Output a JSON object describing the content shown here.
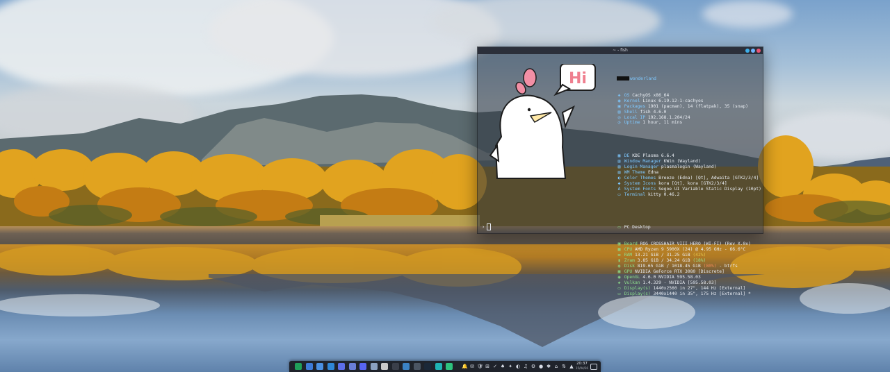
{
  "terminal": {
    "title": "~ - fish",
    "prompt_symbol": "›",
    "user_host": "wonderland",
    "speech_bubble": "Hi",
    "sections": {
      "system": [
        {
          "key": "OS",
          "value": "CachyOS x86_64",
          "icon": "os-icon"
        },
        {
          "key": "Kernel",
          "value": "Linux 6.19.12-1-cachyos",
          "icon": "kernel-icon"
        },
        {
          "key": "Packages",
          "value": "1901 (pacman), 14 (flatpak), 35 (snap)",
          "icon": "package-icon"
        },
        {
          "key": "Shell",
          "value": "fish 4.6.0",
          "icon": "shell-icon"
        },
        {
          "key": "Local IP",
          "value": "192.168.1.204/24",
          "icon": "network-icon"
        },
        {
          "key": "Uptime",
          "value": "1 hour, 11 mins",
          "icon": "clock-icon"
        }
      ],
      "desktop": [
        {
          "key": "DE",
          "value": "KDE Plasma 6.6.4",
          "icon": "de-icon"
        },
        {
          "key": "Window Manager",
          "value": "KWin (Wayland)",
          "icon": "wm-icon"
        },
        {
          "key": "Login Manager",
          "value": "plasmalogin (Wayland)",
          "icon": "login-icon"
        },
        {
          "key": "WM Theme",
          "value": "Edna",
          "icon": "theme-icon"
        },
        {
          "key": "Color Themes",
          "value": "Breeze (Edna) [Qt], Adwaita [GTK2/3/4]",
          "icon": "palette-icon"
        },
        {
          "key": "System Icons",
          "value": "kora [Qt], kora [GTK2/3/4]",
          "icon": "icons-icon"
        },
        {
          "key": "System Fonts",
          "value": "Segoe UI Variable Static Display (10pt)",
          "icon": "font-icon"
        },
        {
          "key": "Terminal",
          "value": "kitty 0.46.2",
          "icon": "terminal-icon"
        }
      ],
      "hardware_title": "PC Desktop",
      "hardware": [
        {
          "key": "Board",
          "value": "ROG CROSSHAIR VIII HERO (WI-FI) (Rev X.0x)",
          "icon": "board-icon"
        },
        {
          "key": "CPU",
          "value": "AMD Ryzen 9 5900X (24) @ 4.95 GHz - 66.6°C",
          "icon": "cpu-icon"
        },
        {
          "key": "RAM",
          "value": "13.21 GiB / 31.25 GiB",
          "pct": "(42%)",
          "pct_class": "pct",
          "icon": "ram-icon"
        },
        {
          "key": "Zram",
          "value": "3.85 GiB / 34.24 GiB",
          "pct": "(18%)",
          "pct_class": "pct-g",
          "icon": "zram-icon"
        },
        {
          "key": "Disk",
          "value": "819.65 GiB / 1018.45 GiB",
          "pct": "(80%)",
          "pct_suffix": " - btrfs",
          "pct_class": "pct-r",
          "icon": "disk-icon"
        },
        {
          "key": "GPU",
          "value": "NVIDIA GeForce RTX 3080 [Discrete]",
          "icon": "gpu-icon"
        },
        {
          "key": "OpenGL",
          "value": "4.6.0 NVIDIA 595.58.03",
          "icon": "opengl-icon"
        },
        {
          "key": "Vulkan",
          "value": "1.4.329 - NVIDIA [595.58.03]",
          "icon": "vulkan-icon"
        },
        {
          "key": "Display(s)",
          "value": "1440x2560 in 27\", 144 Hz [External]",
          "icon": "display-icon"
        },
        {
          "key": "Display(s)",
          "value": "3440x1440 in 35\", 175 Hz [External] *",
          "icon": "display-icon"
        }
      ]
    }
  },
  "taskbar": {
    "apps": [
      {
        "name": "cachyos-launcher-icon",
        "color": "#1fa05a"
      },
      {
        "name": "overview-icon",
        "color": "#3d7bd8"
      },
      {
        "name": "file-manager-icon",
        "color": "#4a90e2"
      },
      {
        "name": "browser-icon",
        "color": "#2f86d6"
      },
      {
        "name": "text-editor-icon",
        "color": "#5d6ee8"
      },
      {
        "name": "app-icon-6",
        "color": "#6a7ed8"
      },
      {
        "name": "discord-icon",
        "color": "#5865f2"
      },
      {
        "name": "app-icon-8",
        "color": "#8aa0c0"
      },
      {
        "name": "app-icon-9",
        "color": "#c9c9c9"
      },
      {
        "name": "terminal-app-icon",
        "color": "#3a3f4a"
      },
      {
        "name": "app-icon-11",
        "color": "#3b82c4"
      },
      {
        "name": "app-icon-12",
        "color": "#4b5563"
      },
      {
        "name": "steam-icon",
        "color": "#1b2838"
      },
      {
        "name": "app-icon-14",
        "color": "#1fb3b3"
      },
      {
        "name": "app-icon-15",
        "color": "#2ec27e"
      }
    ],
    "tray": [
      "🔔",
      "✉",
      "🛡",
      "⊞",
      "✓",
      "♠",
      "✦",
      "◐",
      "♫",
      "⚙",
      "●",
      "✱",
      "⌂",
      "⇅",
      "▲"
    ],
    "clock_time": "20:37",
    "clock_date": "15/04/26"
  }
}
